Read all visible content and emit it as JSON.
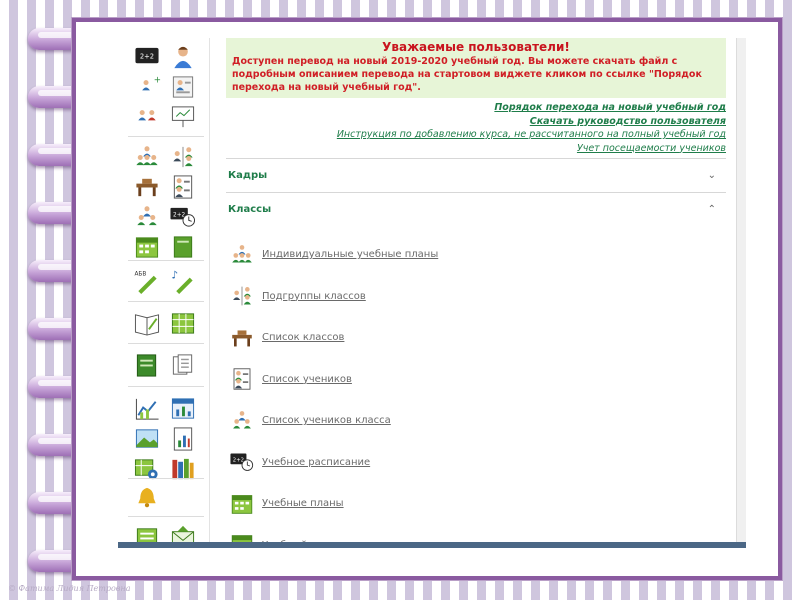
{
  "notice": {
    "title": "Уважаемые пользователи!",
    "text": "Доступен перевод на новый 2019-2020 учебный год. Вы можете скачать файл с подробным описанием перевода на стартовом виджете кликом по ссылке \"Порядок перехода на новый учебный год\"."
  },
  "links": [
    {
      "label": "Порядок перехода на новый учебный год",
      "bold": true
    },
    {
      "label": "Скачать руководство пользователя",
      "bold": true
    },
    {
      "label": "Инструкция по добавлению курса, не рассчитанного на полный учебный год",
      "bold": false
    },
    {
      "label": "Учет посещаемости учеников",
      "bold": false
    }
  ],
  "sections": {
    "staff": {
      "title": "Кадры",
      "arrow": "⌄"
    },
    "classes": {
      "title": "Классы",
      "arrow": "⌃"
    }
  },
  "class_items": [
    {
      "label": "Индивидуальные учебные планы",
      "icon": "people-group-icon"
    },
    {
      "label": "Подгруппы классов",
      "icon": "subgroups-icon"
    },
    {
      "label": "Список классов",
      "icon": "desk-icon"
    },
    {
      "label": "Список учеников",
      "icon": "student-list-icon"
    },
    {
      "label": "Список учеников класса",
      "icon": "class-students-icon"
    },
    {
      "label": "Учебное расписание",
      "icon": "schedule-icon"
    },
    {
      "label": "Учебные планы",
      "icon": "calendar-icon"
    },
    {
      "label": "Учебный журнал",
      "icon": "journal-icon"
    }
  ],
  "sidebar_icons": [
    "math-board-icon",
    "teacher-icon",
    "staff-add-icon",
    "id-card-icon",
    "users-icon",
    "presentation-icon",
    "people-group-icon",
    "subgroups-icon",
    "desk-icon",
    "student-list-icon",
    "class-students-icon",
    "schedule-icon",
    "calendar-icon",
    "notebook-icon",
    "abc-pencil-icon",
    "music-pencil-icon",
    "open-book-icon",
    "table-grid-icon",
    "green-book-icon",
    "documents-icon",
    "line-chart-icon",
    "calendar-chart-icon",
    "picture-icon",
    "report-icon",
    "settings-table-icon",
    "books-icon",
    "bell-icon",
    "sheet-icon",
    "envelope-icon"
  ],
  "colors": {
    "accent_green": "#1f7d4a",
    "notice_red": "#d01e25",
    "notice_bg": "#e7f5d7",
    "frame_purple": "#8a5aa0"
  },
  "copyright": "© Фатима Лидия Петровна"
}
